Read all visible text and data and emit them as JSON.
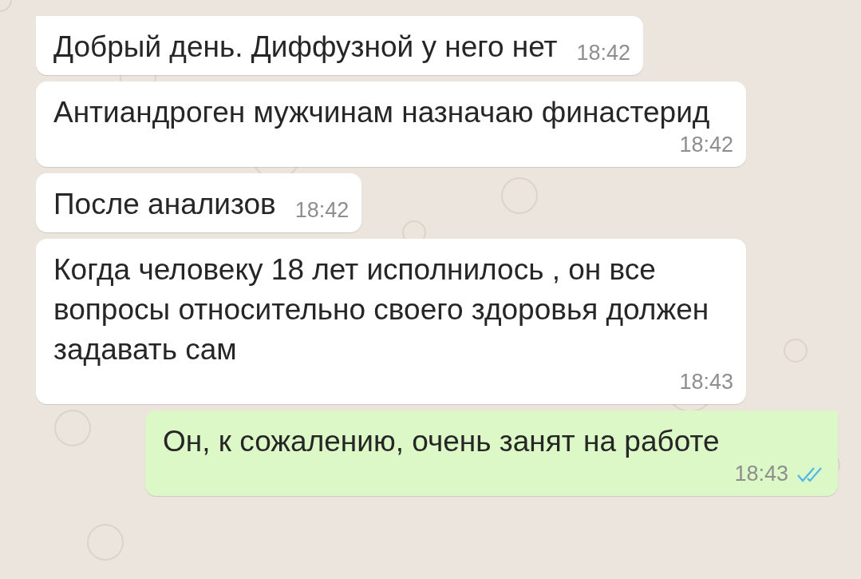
{
  "messages": [
    {
      "kind": "incoming",
      "tail": true,
      "text": "Добрый день. Диффузной у него нет",
      "time": "18:42"
    },
    {
      "kind": "incoming",
      "tail": false,
      "text": "Антиандроген мужчинам назначаю финастерид",
      "time": "18:42"
    },
    {
      "kind": "incoming",
      "tail": false,
      "text": "После анализов",
      "time": "18:42"
    },
    {
      "kind": "incoming",
      "tail": false,
      "text": "Когда человеку 18 лет исполнилось , он все вопросы относительно своего здоровья должен задавать сам",
      "time": "18:43"
    },
    {
      "kind": "outgoing",
      "tail": true,
      "text": "Он, к сожалению, очень занят на работе",
      "time": "18:43",
      "read": true
    }
  ]
}
